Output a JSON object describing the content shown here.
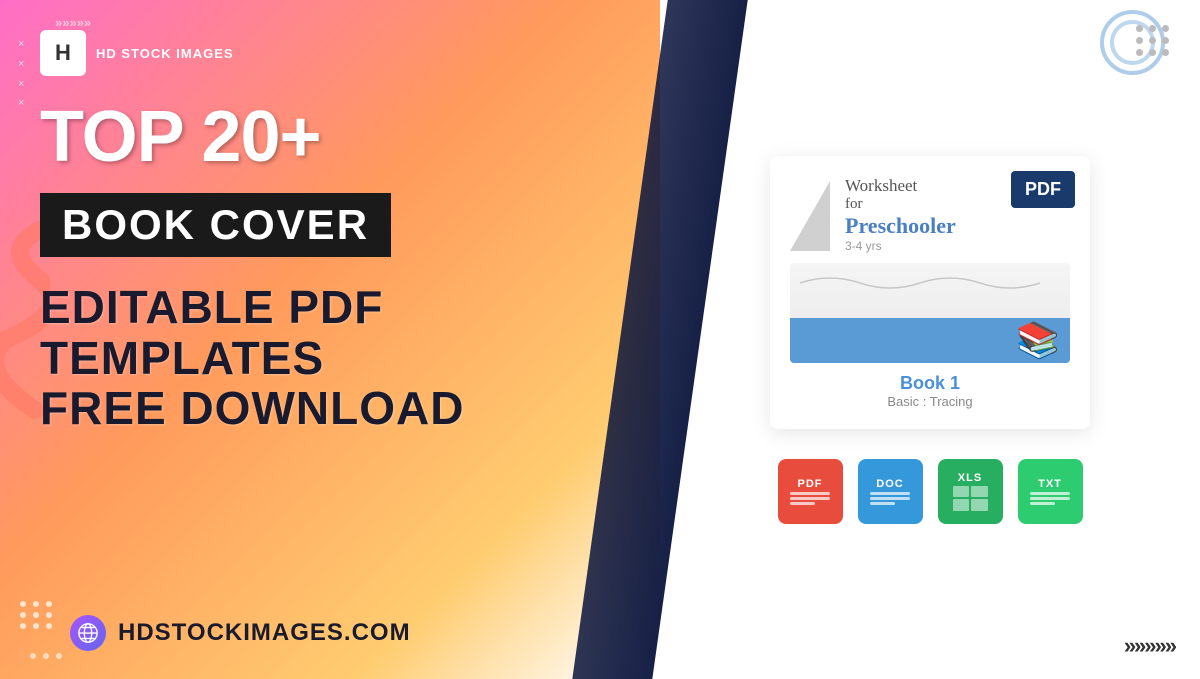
{
  "background": {
    "gradient_from": "#ff6ec7",
    "gradient_to": "#ffcc70"
  },
  "logo": {
    "letter": "H",
    "name": "HD STOCK IMAGES"
  },
  "headline": {
    "top": "TOP 20+",
    "badge": "BOOK COVER",
    "sub1": "EDITABLE PDF TEMPLATES",
    "sub2": "FREE DOWNLOAD"
  },
  "website": {
    "url": "HDSTOCKIMAGES.COM"
  },
  "book_preview": {
    "title_line1": "Worksheet",
    "title_line2": "for",
    "title_line3": "Preschooler",
    "age": "3-4 yrs",
    "pdf_badge": "PDF",
    "book_num": "Book 1",
    "book_sub": "Basic : Tracing"
  },
  "format_icons": [
    {
      "label": "PDF",
      "type": "pdf"
    },
    {
      "label": "DOC",
      "type": "doc"
    },
    {
      "label": "XLS",
      "type": "xls"
    },
    {
      "label": "TXT",
      "type": "txt"
    }
  ],
  "decorations": {
    "top_left_arrows": "»»»»»",
    "bottom_right_chevrons": "»»»»»",
    "top_right_dots": "•••",
    "x_marks": "×"
  }
}
